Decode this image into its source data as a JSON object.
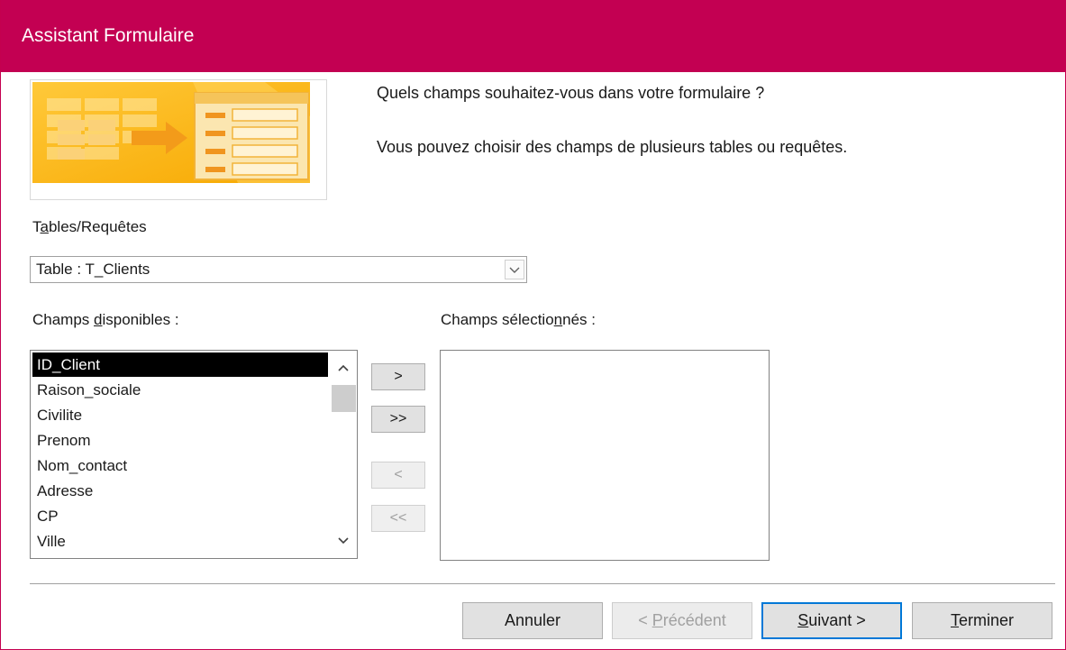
{
  "window": {
    "title": "Assistant Formulaire"
  },
  "intro": {
    "question": "Quels champs souhaitez-vous dans votre formulaire ?",
    "hint": "Vous pouvez choisir des champs de plusieurs tables ou requêtes."
  },
  "tables": {
    "label_before": "T",
    "label_accel": "a",
    "label_after": "bles/Requêtes",
    "selected": "Table : T_Clients"
  },
  "available": {
    "label_before": "Champs ",
    "label_accel": "d",
    "label_after": "isponibles :",
    "items": [
      "ID_Client",
      "Raison_sociale",
      "Civilite",
      "Prenom",
      "Nom_contact",
      "Adresse",
      "CP",
      "Ville"
    ],
    "selected_index": 0
  },
  "selected_fields": {
    "label_before": "Champs sélectio",
    "label_accel": "n",
    "label_after": "nés :",
    "items": []
  },
  "move_buttons": {
    "add_one": ">",
    "add_all": ">>",
    "remove_one": "<",
    "remove_all": "<<"
  },
  "footer": {
    "cancel": "Annuler",
    "prev_before": "< ",
    "prev_accel": "P",
    "prev_after": "récédent",
    "next_accel": "S",
    "next_after": "uivant >",
    "finish_accel": "T",
    "finish_after": "erminer"
  },
  "colors": {
    "titlebar": "#c30052",
    "selection": "#000000",
    "default_button_border": "#0078d7"
  },
  "icons": {
    "combo_arrow": "chevron-down-icon",
    "scroll_up": "chevron-up-icon",
    "scroll_down": "chevron-down-icon"
  }
}
